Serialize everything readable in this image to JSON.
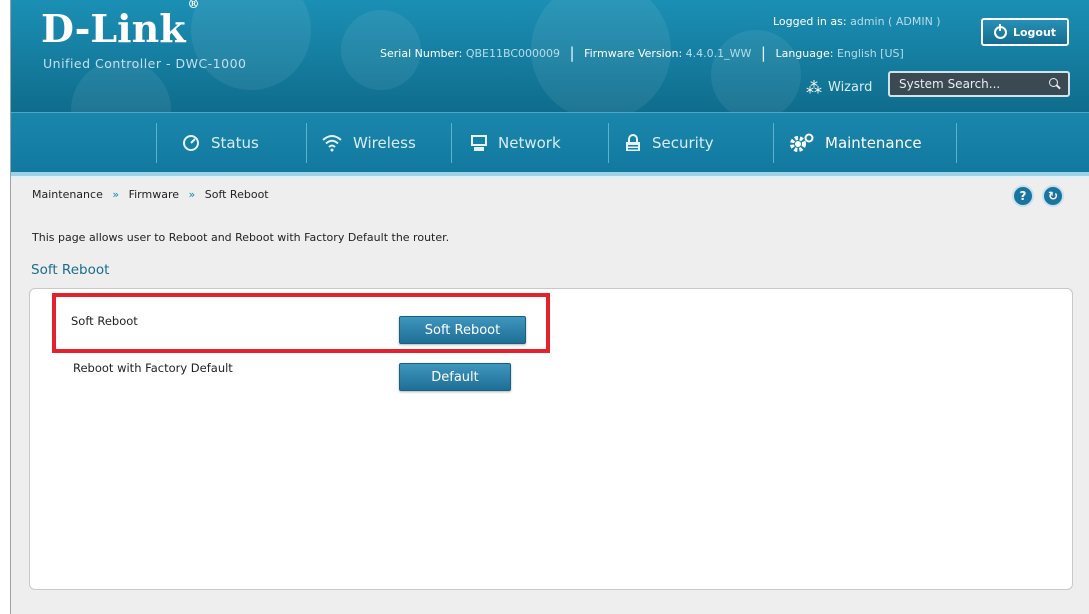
{
  "header": {
    "brand": "D-Link",
    "brand_mark": "®",
    "product": "Unified Controller - DWC-1000",
    "logged_in_label": "Logged in as:",
    "logged_in_value": "admin ( ADMIN )",
    "logout_label": "Logout",
    "serial_label": "Serial Number:",
    "serial_value": "QBE11BC000009",
    "firmware_label": "Firmware Version:",
    "firmware_value": "4.4.0.1_WW",
    "language_label": "Language:",
    "language_value": "English [US]",
    "wizard_label": "Wizard",
    "search_placeholder": "System Search..."
  },
  "nav": {
    "items": [
      {
        "label": "Status",
        "icon": "gauge-icon"
      },
      {
        "label": "Wireless",
        "icon": "wifi-icon"
      },
      {
        "label": "Network",
        "icon": "monitor-icon"
      },
      {
        "label": "Security",
        "icon": "lock-icon"
      },
      {
        "label": "Maintenance",
        "icon": "gears-icon"
      }
    ],
    "active": "Maintenance"
  },
  "breadcrumb": {
    "items": [
      "Maintenance",
      "Firmware",
      "Soft Reboot"
    ],
    "separator": "»"
  },
  "page": {
    "description": "This page allows user to Reboot and Reboot with Factory Default the router.",
    "section_title": "Soft Reboot",
    "rows": [
      {
        "label": "Soft Reboot",
        "button": "Soft Reboot"
      },
      {
        "label": "Reboot with Factory Default",
        "button": "Default"
      }
    ]
  },
  "colors": {
    "header_blue": "#1680a3",
    "highlight_red": "#e3222d",
    "button_blue": "#2b82ab"
  }
}
